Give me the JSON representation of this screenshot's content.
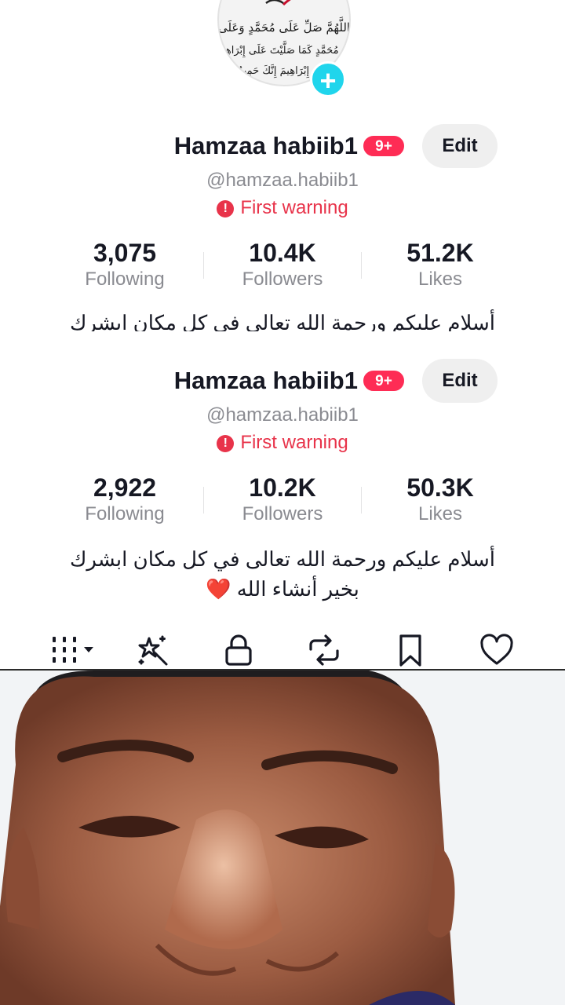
{
  "avatar": {
    "icon": "calligraphy-avatar",
    "calligraphy_lines": [
      "اللَّهُمَّ صَلِّ عَلَى مُحَمَّدٍ وَعَلَى",
      "آلِ مُحَمَّدٍ كَمَا صَلَّيْتَ عَلَى إِبْرَاهِيمَ",
      "إِبْرَاهِيمَ إِنَّكَ حَمِيدٌ"
    ],
    "add_icon": "plus-icon",
    "accent": "#20d5ec"
  },
  "profile_current": {
    "name": "Hamzaa habiib1",
    "badge": "9+",
    "edit_label": "Edit",
    "handle": "@hamzaa.habiib1",
    "warning": "First warning",
    "stats": [
      {
        "value": "3,075",
        "label": "Following"
      },
      {
        "value": "10.4K",
        "label": "Followers"
      },
      {
        "value": "51.2K",
        "label": "Likes"
      }
    ],
    "bio": "أسلام عليكم ورحمة الله تعالى فى كل مكان ابشرك"
  },
  "profile_previous": {
    "name": "Hamzaa habiib1",
    "badge": "9+",
    "edit_label": "Edit",
    "handle": "@hamzaa.habiib1",
    "warning": "First warning",
    "stats": [
      {
        "value": "2,922",
        "label": "Following"
      },
      {
        "value": "10.2K",
        "label": "Followers"
      },
      {
        "value": "50.3K",
        "label": "Likes"
      }
    ],
    "bio_line1": "أسلام عليكم ورحمة الله تعالى في كل مكان ابشرك",
    "bio_line2": "بخير أنشاء الله ❤️"
  },
  "tabs": [
    {
      "icon": "grid-dropdown-icon"
    },
    {
      "icon": "sparkle-effects-icon"
    },
    {
      "icon": "lock-icon"
    },
    {
      "icon": "repost-icon"
    },
    {
      "icon": "bookmark-icon"
    },
    {
      "icon": "heart-icon"
    }
  ],
  "colors": {
    "badge": "#fe2c55",
    "warning": "#e8334a",
    "secondary_text": "#8a8b91",
    "edit_button_bg": "#efefef"
  },
  "photo": {
    "subject": "selfie-photo"
  }
}
